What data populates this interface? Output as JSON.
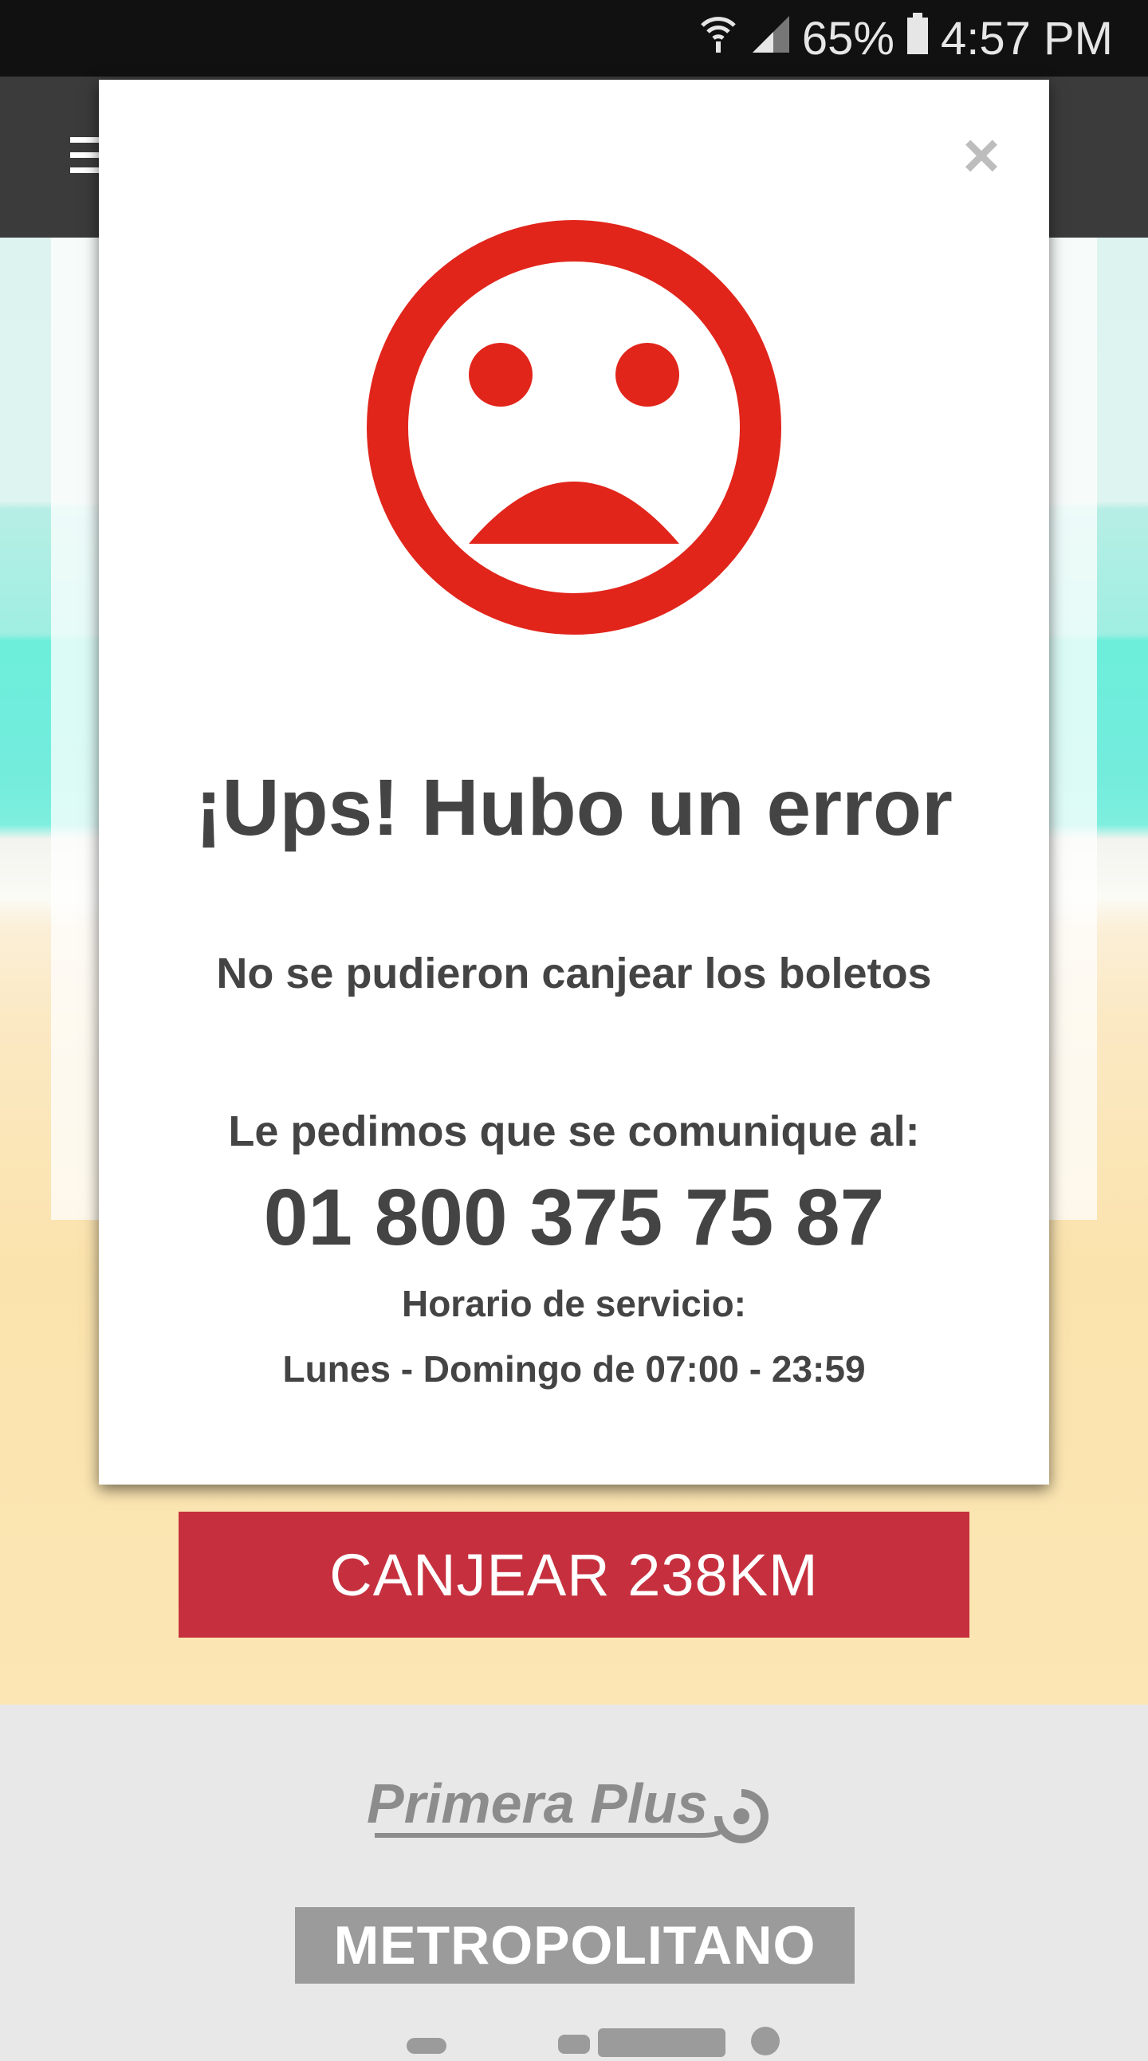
{
  "status_bar": {
    "battery": "65%",
    "time": "4:57 PM",
    "icons": [
      "wifi-icon",
      "signal-icon",
      "battery-icon"
    ]
  },
  "app_bar": {
    "icon": "menu-icon"
  },
  "modal": {
    "close_label": "×",
    "icon": "sad-face-icon",
    "title": "¡Ups! Hubo un error",
    "message": "No se pudieron canjear los boletos",
    "contact_label": "Le pedimos que se comunique al:",
    "phone": "01 800 375 75 87",
    "hours_label": "Horario de servicio:",
    "hours_value": "Lunes - Domingo de 07:00 - 23:59"
  },
  "redeem_button": {
    "label": "CANJEAR 238KM"
  },
  "footer": {
    "logos": [
      "Primera Plus",
      "METROPOLITANO"
    ]
  },
  "colors": {
    "error_red": "#e1251b",
    "button_red": "#c6303e",
    "text_dark": "#444444",
    "status_bar_bg": "#111111",
    "app_bar_bg": "#3b3b3b"
  }
}
